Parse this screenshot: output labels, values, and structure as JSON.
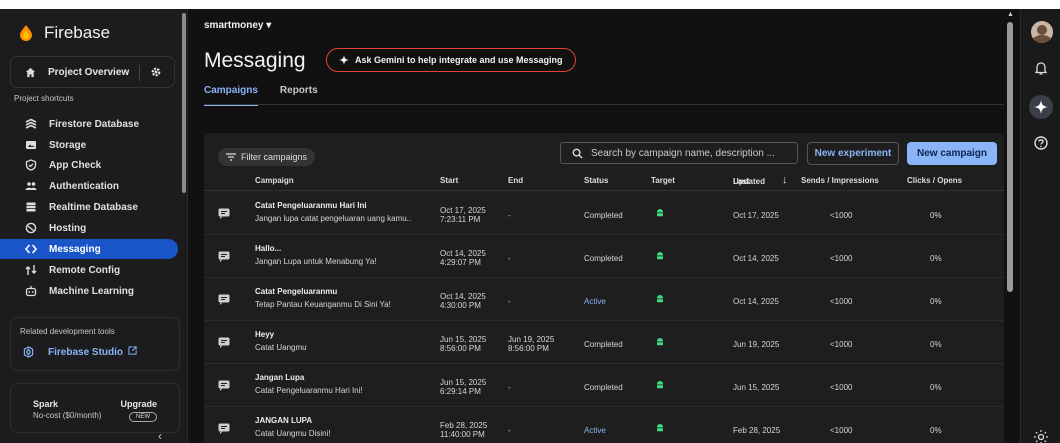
{
  "sidebar": {
    "brand": "Firebase",
    "project_overview": "Project Overview",
    "shortcuts_label": "Project shortcuts",
    "items": [
      {
        "label": "Firestore Database",
        "icon": "firestore-icon"
      },
      {
        "label": "Storage",
        "icon": "storage-icon"
      },
      {
        "label": "App Check",
        "icon": "app-check-icon"
      },
      {
        "label": "Authentication",
        "icon": "authentication-icon"
      },
      {
        "label": "Realtime Database",
        "icon": "realtime-database-icon"
      },
      {
        "label": "Hosting",
        "icon": "hosting-icon"
      },
      {
        "label": "Messaging",
        "icon": "messaging-icon",
        "active": true
      },
      {
        "label": "Remote Config",
        "icon": "remote-config-icon"
      },
      {
        "label": "Machine Learning",
        "icon": "machine-learning-icon"
      }
    ],
    "related_label": "Related development tools",
    "studio": "Firebase Studio",
    "plan": {
      "name": "Spark",
      "cost": "No-cost ($0/month)",
      "upgrade": "Upgrade",
      "badge": "NEW"
    }
  },
  "header": {
    "project": "smartmoney",
    "title": "Messaging",
    "gemini": "Ask Gemini to help integrate and use Messaging",
    "tabs": [
      "Campaigns",
      "Reports"
    ]
  },
  "toolbar": {
    "filter": "Filter campaigns",
    "search_placeholder": "Search by campaign name, description ...",
    "new_experiment": "New experiment",
    "new_campaign": "New campaign"
  },
  "table": {
    "columns": {
      "campaign": "Campaign",
      "start": "Start",
      "end": "End",
      "status": "Status",
      "target": "Target",
      "last_updated_1": "Last",
      "last_updated_2": "Updated",
      "sends": "Sends / Impressions",
      "clicks": "Clicks / Opens"
    },
    "rows": [
      {
        "title": "Catat Pengeluaranmu Hari Ini",
        "body": "Jangan lupa catat pengeluaran uang kamu..",
        "start_date": "Oct 17, 2025",
        "start_time": "7:23:11 PM",
        "end_date": "-",
        "end_time": "",
        "status": "Completed",
        "updated": "Oct 17, 2025",
        "sends": "<1000",
        "clicks": "0%"
      },
      {
        "title": "Hallo...",
        "body": "Jangan Lupa untuk Menabung Ya!",
        "start_date": "Oct 14, 2025",
        "start_time": "4:29:07 PM",
        "end_date": "-",
        "end_time": "",
        "status": "Completed",
        "updated": "Oct 14, 2025",
        "sends": "<1000",
        "clicks": "0%"
      },
      {
        "title": "Catat Pengeluaranmu",
        "body": "Tetap Pantau Keuanganmu Di Sini Ya!",
        "start_date": "Oct 14, 2025",
        "start_time": "4:30:00 PM",
        "end_date": "-",
        "end_time": "",
        "status": "Active",
        "updated": "Oct 14, 2025",
        "sends": "<1000",
        "clicks": "0%"
      },
      {
        "title": "Heyy",
        "body": "Catat Uangmu",
        "start_date": "Jun 15, 2025",
        "start_time": "8:56:00 PM",
        "end_date": "Jun 19, 2025",
        "end_time": "8:56:00 PM",
        "status": "Completed",
        "updated": "Jun 19, 2025",
        "sends": "<1000",
        "clicks": "0%"
      },
      {
        "title": "Jangan Lupa",
        "body": "Catat Pengeluaranmu Hari Ini!",
        "start_date": "Jun 15, 2025",
        "start_time": "6:29:14 PM",
        "end_date": "-",
        "end_time": "",
        "status": "Completed",
        "updated": "Jun 15, 2025",
        "sends": "<1000",
        "clicks": "0%"
      },
      {
        "title": "JANGAN LUPA",
        "body": "Catat Uangmu Disini!",
        "start_date": "Feb 28, 2025",
        "start_time": "11:40:00 PM",
        "end_date": "-",
        "end_time": "",
        "status": "Active",
        "updated": "Feb 28, 2025",
        "sends": "<1000",
        "clicks": "0%"
      }
    ]
  },
  "colors": {
    "accent": "#8ab4f8",
    "active_nav": "#1a55c7",
    "gemini_border": "#e0453a",
    "target_icon": "#3ddc84"
  }
}
